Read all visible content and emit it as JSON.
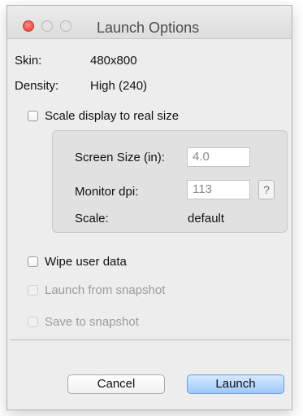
{
  "window": {
    "title": "Launch Options"
  },
  "info": {
    "skin_label": "Skin:",
    "skin_value": "480x800",
    "density_label": "Density:",
    "density_value": "High (240)"
  },
  "scale_checkbox": {
    "label": "Scale display to real size",
    "checked": false
  },
  "scale_group": {
    "screen_size_label": "Screen Size (in):",
    "screen_size_value": "4.0",
    "monitor_dpi_label": "Monitor dpi:",
    "monitor_dpi_value": "113",
    "help_label": "?",
    "scale_label": "Scale:",
    "scale_value": "default"
  },
  "options": {
    "wipe_user_data": {
      "label": "Wipe user data",
      "checked": false,
      "enabled": true
    },
    "launch_from_snapshot": {
      "label": "Launch from snapshot",
      "checked": false,
      "enabled": false
    },
    "save_to_snapshot": {
      "label": "Save to snapshot",
      "checked": false,
      "enabled": false
    }
  },
  "buttons": {
    "cancel_label": "Cancel",
    "launch_label": "Launch"
  },
  "colors": {
    "close_button": "#f05a4f",
    "default_button": "#9cc8fb",
    "disabled_text": "#9c9c9c"
  }
}
